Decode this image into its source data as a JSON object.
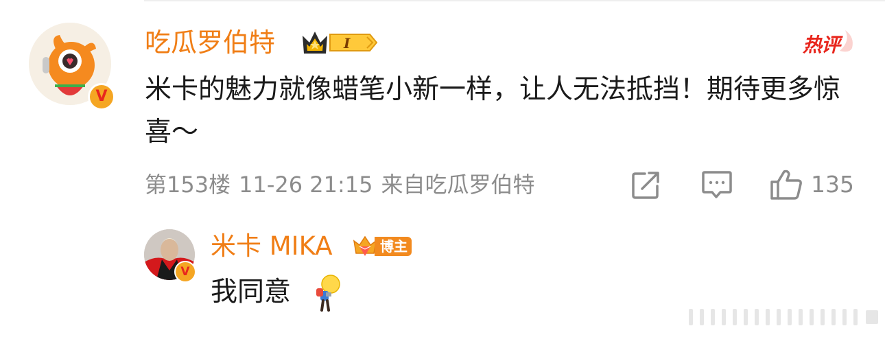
{
  "comment": {
    "username": "吃瓜罗伯特",
    "level_badge": "I",
    "hot_tag": "热评",
    "text": "米卡的魅力就像蜡笔小新一样，让人无法抵挡！期待更多惊喜～",
    "floor": "第153楼",
    "time": "11-26 21:15",
    "source": "来自吃瓜罗伯特",
    "like_count": "135",
    "verified_mark": "V"
  },
  "reply": {
    "username": "米卡 MIKA",
    "role_badge": "博主",
    "text": "我同意",
    "verified_mark": "V"
  },
  "icons": {
    "share": "share-icon",
    "comment": "comment-icon",
    "like": "like-icon",
    "bulb": "bulb-emoji-icon",
    "crown": "crown-icon"
  },
  "colors": {
    "username": "#f07e16",
    "hot": "#e8261d",
    "meta": "#8c8c8c",
    "badge": "#f5a623"
  }
}
